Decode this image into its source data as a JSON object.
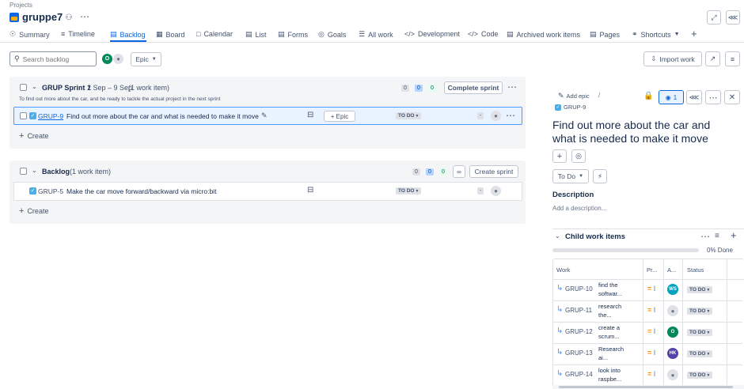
{
  "breadcrumb": "Projects",
  "project": {
    "name": "gruppe7"
  },
  "tabs": [
    {
      "label": "Summary",
      "icon": "globe-icon"
    },
    {
      "label": "Timeline",
      "icon": "timeline-icon"
    },
    {
      "label": "Backlog",
      "icon": "backlog-icon",
      "active": true
    },
    {
      "label": "Board",
      "icon": "board-icon"
    },
    {
      "label": "Calendar",
      "icon": "calendar-icon"
    },
    {
      "label": "List",
      "icon": "list-icon"
    },
    {
      "label": "Forms",
      "icon": "forms-icon"
    },
    {
      "label": "Goals",
      "icon": "goals-icon"
    },
    {
      "label": "All work",
      "icon": "all-work-icon"
    },
    {
      "label": "Development",
      "icon": "development-icon"
    },
    {
      "label": "Code",
      "icon": "code-icon"
    },
    {
      "label": "Archived work items",
      "icon": "archive-icon"
    },
    {
      "label": "Pages",
      "icon": "pages-icon"
    },
    {
      "label": "Shortcuts",
      "icon": "shortcuts-icon"
    }
  ],
  "toolbar": {
    "search_placeholder": "Search backlog",
    "avatar_initial": "O",
    "epic_filter": "Epic",
    "import_label": "Import work"
  },
  "sprint": {
    "title": "GRUP Sprint 1",
    "dates": "2 Sep – 9 Sep",
    "count": "(1 work item)",
    "goal": "To find out more about the car, and be ready to tackle the actual project in the next sprint",
    "counts": [
      "0",
      "0",
      "0"
    ],
    "action": "Complete sprint",
    "item": {
      "key": "GRUP-9",
      "summary": "Find out more about the car and what is needed to make it move",
      "epic": "+ Epic",
      "status": "TO DO",
      "points": "-"
    },
    "create": "Create"
  },
  "backlog": {
    "title": "Backlog",
    "count": "(1 work item)",
    "counts": [
      "0",
      "0",
      "0"
    ],
    "action": "Create sprint",
    "item": {
      "key": "GRUP-5",
      "summary": "Make the car move forward/backward via micro:bit",
      "status": "TO DO",
      "points": "-"
    },
    "create": "Create"
  },
  "detail": {
    "add_epic": "Add epic",
    "separator": "/",
    "key": "GRUP-9",
    "watch_count": "1",
    "title": "Find out more about the car and what is needed to make it move",
    "status": "To Do",
    "description_label": "Description",
    "description_placeholder": "Add a description...",
    "child_title": "Child work items",
    "progress_label": "0% Done",
    "progress_fraction": 0,
    "columns": [
      "Work",
      "Pr...",
      "A...",
      "Status"
    ],
    "children": [
      {
        "key": "GRUP-10",
        "summary1": "find the",
        "summary2": "softwar...",
        "prio": "=",
        "assignee": "WS",
        "assignee_color": "#00a3bf",
        "status": "TO DO"
      },
      {
        "key": "GRUP-11",
        "summary1": "research",
        "summary2": "the...",
        "prio": "=",
        "assignee": "",
        "assignee_color": "",
        "status": "TO DO"
      },
      {
        "key": "GRUP-12",
        "summary1": "create a",
        "summary2": "scrum...",
        "prio": "=",
        "assignee": "O",
        "assignee_color": "#00875a",
        "status": "TO DO"
      },
      {
        "key": "GRUP-13",
        "summary1": "Research",
        "summary2": "ai...",
        "prio": "=",
        "assignee": "HK",
        "assignee_color": "#5243aa",
        "status": "TO DO"
      },
      {
        "key": "GRUP-14",
        "summary1": "look into",
        "summary2": "raspbe...",
        "prio": "=",
        "assignee": "",
        "assignee_color": "",
        "status": "TO DO"
      }
    ]
  }
}
